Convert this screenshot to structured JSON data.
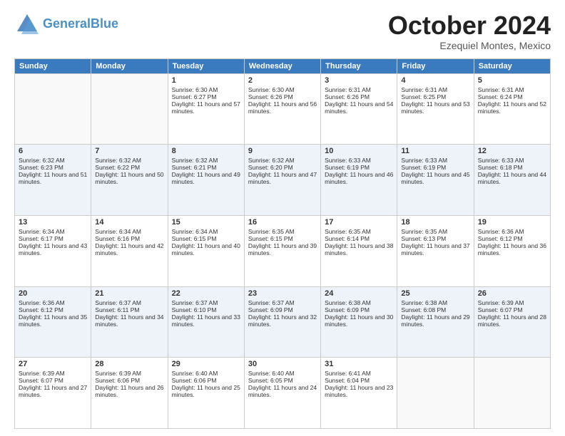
{
  "header": {
    "logo_line1": "General",
    "logo_line2": "Blue",
    "month": "October 2024",
    "location": "Ezequiel Montes, Mexico"
  },
  "days_of_week": [
    "Sunday",
    "Monday",
    "Tuesday",
    "Wednesday",
    "Thursday",
    "Friday",
    "Saturday"
  ],
  "weeks": [
    [
      {
        "day": "",
        "info": ""
      },
      {
        "day": "",
        "info": ""
      },
      {
        "day": "1",
        "info": "Sunrise: 6:30 AM\nSunset: 6:27 PM\nDaylight: 11 hours and 57 minutes."
      },
      {
        "day": "2",
        "info": "Sunrise: 6:30 AM\nSunset: 6:26 PM\nDaylight: 11 hours and 56 minutes."
      },
      {
        "day": "3",
        "info": "Sunrise: 6:31 AM\nSunset: 6:26 PM\nDaylight: 11 hours and 54 minutes."
      },
      {
        "day": "4",
        "info": "Sunrise: 6:31 AM\nSunset: 6:25 PM\nDaylight: 11 hours and 53 minutes."
      },
      {
        "day": "5",
        "info": "Sunrise: 6:31 AM\nSunset: 6:24 PM\nDaylight: 11 hours and 52 minutes."
      }
    ],
    [
      {
        "day": "6",
        "info": "Sunrise: 6:32 AM\nSunset: 6:23 PM\nDaylight: 11 hours and 51 minutes."
      },
      {
        "day": "7",
        "info": "Sunrise: 6:32 AM\nSunset: 6:22 PM\nDaylight: 11 hours and 50 minutes."
      },
      {
        "day": "8",
        "info": "Sunrise: 6:32 AM\nSunset: 6:21 PM\nDaylight: 11 hours and 49 minutes."
      },
      {
        "day": "9",
        "info": "Sunrise: 6:32 AM\nSunset: 6:20 PM\nDaylight: 11 hours and 47 minutes."
      },
      {
        "day": "10",
        "info": "Sunrise: 6:33 AM\nSunset: 6:19 PM\nDaylight: 11 hours and 46 minutes."
      },
      {
        "day": "11",
        "info": "Sunrise: 6:33 AM\nSunset: 6:19 PM\nDaylight: 11 hours and 45 minutes."
      },
      {
        "day": "12",
        "info": "Sunrise: 6:33 AM\nSunset: 6:18 PM\nDaylight: 11 hours and 44 minutes."
      }
    ],
    [
      {
        "day": "13",
        "info": "Sunrise: 6:34 AM\nSunset: 6:17 PM\nDaylight: 11 hours and 43 minutes."
      },
      {
        "day": "14",
        "info": "Sunrise: 6:34 AM\nSunset: 6:16 PM\nDaylight: 11 hours and 42 minutes."
      },
      {
        "day": "15",
        "info": "Sunrise: 6:34 AM\nSunset: 6:15 PM\nDaylight: 11 hours and 40 minutes."
      },
      {
        "day": "16",
        "info": "Sunrise: 6:35 AM\nSunset: 6:15 PM\nDaylight: 11 hours and 39 minutes."
      },
      {
        "day": "17",
        "info": "Sunrise: 6:35 AM\nSunset: 6:14 PM\nDaylight: 11 hours and 38 minutes."
      },
      {
        "day": "18",
        "info": "Sunrise: 6:35 AM\nSunset: 6:13 PM\nDaylight: 11 hours and 37 minutes."
      },
      {
        "day": "19",
        "info": "Sunrise: 6:36 AM\nSunset: 6:12 PM\nDaylight: 11 hours and 36 minutes."
      }
    ],
    [
      {
        "day": "20",
        "info": "Sunrise: 6:36 AM\nSunset: 6:12 PM\nDaylight: 11 hours and 35 minutes."
      },
      {
        "day": "21",
        "info": "Sunrise: 6:37 AM\nSunset: 6:11 PM\nDaylight: 11 hours and 34 minutes."
      },
      {
        "day": "22",
        "info": "Sunrise: 6:37 AM\nSunset: 6:10 PM\nDaylight: 11 hours and 33 minutes."
      },
      {
        "day": "23",
        "info": "Sunrise: 6:37 AM\nSunset: 6:09 PM\nDaylight: 11 hours and 32 minutes."
      },
      {
        "day": "24",
        "info": "Sunrise: 6:38 AM\nSunset: 6:09 PM\nDaylight: 11 hours and 30 minutes."
      },
      {
        "day": "25",
        "info": "Sunrise: 6:38 AM\nSunset: 6:08 PM\nDaylight: 11 hours and 29 minutes."
      },
      {
        "day": "26",
        "info": "Sunrise: 6:39 AM\nSunset: 6:07 PM\nDaylight: 11 hours and 28 minutes."
      }
    ],
    [
      {
        "day": "27",
        "info": "Sunrise: 6:39 AM\nSunset: 6:07 PM\nDaylight: 11 hours and 27 minutes."
      },
      {
        "day": "28",
        "info": "Sunrise: 6:39 AM\nSunset: 6:06 PM\nDaylight: 11 hours and 26 minutes."
      },
      {
        "day": "29",
        "info": "Sunrise: 6:40 AM\nSunset: 6:06 PM\nDaylight: 11 hours and 25 minutes."
      },
      {
        "day": "30",
        "info": "Sunrise: 6:40 AM\nSunset: 6:05 PM\nDaylight: 11 hours and 24 minutes."
      },
      {
        "day": "31",
        "info": "Sunrise: 6:41 AM\nSunset: 6:04 PM\nDaylight: 11 hours and 23 minutes."
      },
      {
        "day": "",
        "info": ""
      },
      {
        "day": "",
        "info": ""
      }
    ]
  ]
}
